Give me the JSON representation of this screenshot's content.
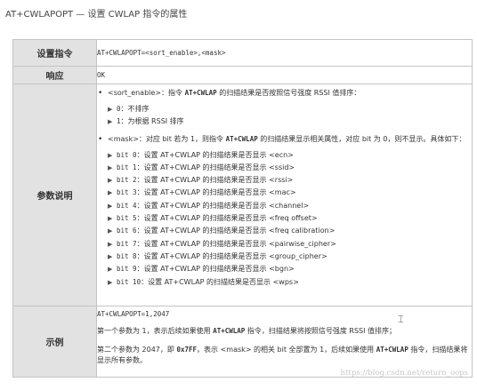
{
  "title": "AT+CWLAPOPT — 设置 CWLAP 指令的属性",
  "rows": {
    "set": {
      "label": "设置指令",
      "value": "AT+CWLAPOPT=<sort_enable>,<mask>"
    },
    "resp": {
      "label": "响应",
      "value": "OK"
    },
    "params": {
      "label": "参数说明",
      "sort": {
        "head_a": "<sort_enable>：指令 ",
        "cmd": "AT+CWLAP",
        "head_b": " 的扫描结果是否按照信号强度 RSSI 值排序：",
        "items": [
          {
            "code": "0",
            "text": "：不排序"
          },
          {
            "code": "1",
            "text": "：为根据 RSSI 排序"
          }
        ]
      },
      "mask": {
        "head_a": "<mask>：对应 bit 若为 1，则指令 ",
        "cmd": "AT+CWLAP",
        "head_b": " 的扫描结果显示相关属性，对应 bit 为 0，则不显示。具体如下：",
        "items": [
          {
            "code": "bit 0",
            "text": "：设置 AT+CWLAP 的扫描结果是否显示 <ecn>"
          },
          {
            "code": "bit 1",
            "text": "：设置 AT+CWLAP 的扫描结果是否显示 <ssid>"
          },
          {
            "code": "bit 2",
            "text": "：设置 AT+CWLAP 的扫描结果是否显示 <rssi>"
          },
          {
            "code": "bit 3",
            "text": "：设置 AT+CWLAP 的扫描结果是否显示 <mac>"
          },
          {
            "code": "bit 4",
            "text": "：设置 AT+CWLAP 的扫描结果是否显示 <channel>"
          },
          {
            "code": "bit 5",
            "text": "：设置 AT+CWLAP 的扫描结果是否显示 <freq offset>"
          },
          {
            "code": "bit 6",
            "text": "：设置 AT+CWLAP 的扫描结果是否显示 <freq calibration>"
          },
          {
            "code": "bit 7",
            "text": "：设置 AT+CWLAP 的扫描结果是否显示 <pairwise_cipher>"
          },
          {
            "code": "bit 8",
            "text": "：设置 AT+CWLAP 的扫描结果是否显示 <group_cipher>"
          },
          {
            "code": "bit 9",
            "text": "：设置 AT+CWLAP 的扫描结果是否显示 <bgn>"
          },
          {
            "code": "bit 10",
            "text": "：设置 AT+CWLAP 的扫描结果是否显示 <wps>"
          }
        ]
      }
    },
    "example": {
      "label": "示例",
      "code": "AT+CWLAPOPT=1,2047",
      "p1_a": "第一个参数为 1，表示后续如果使用 ",
      "p1_cmd": "AT+CWLAP",
      "p1_b": " 指令，扫描结果将按照信号强度 RSSI 值排序；",
      "p2_a": "第二个参数为 2047，即 ",
      "p2_hex": "0x7FF",
      "p2_b": "，表示 <mask> 的相关 bit 全部置为 1，后续如果使用 ",
      "p2_cmd": "AT+CWLAP",
      "p2_c": " 指令，扫描结果将显示所有参数。"
    }
  },
  "watermark": "https://blog.csdn.net/return_oops"
}
